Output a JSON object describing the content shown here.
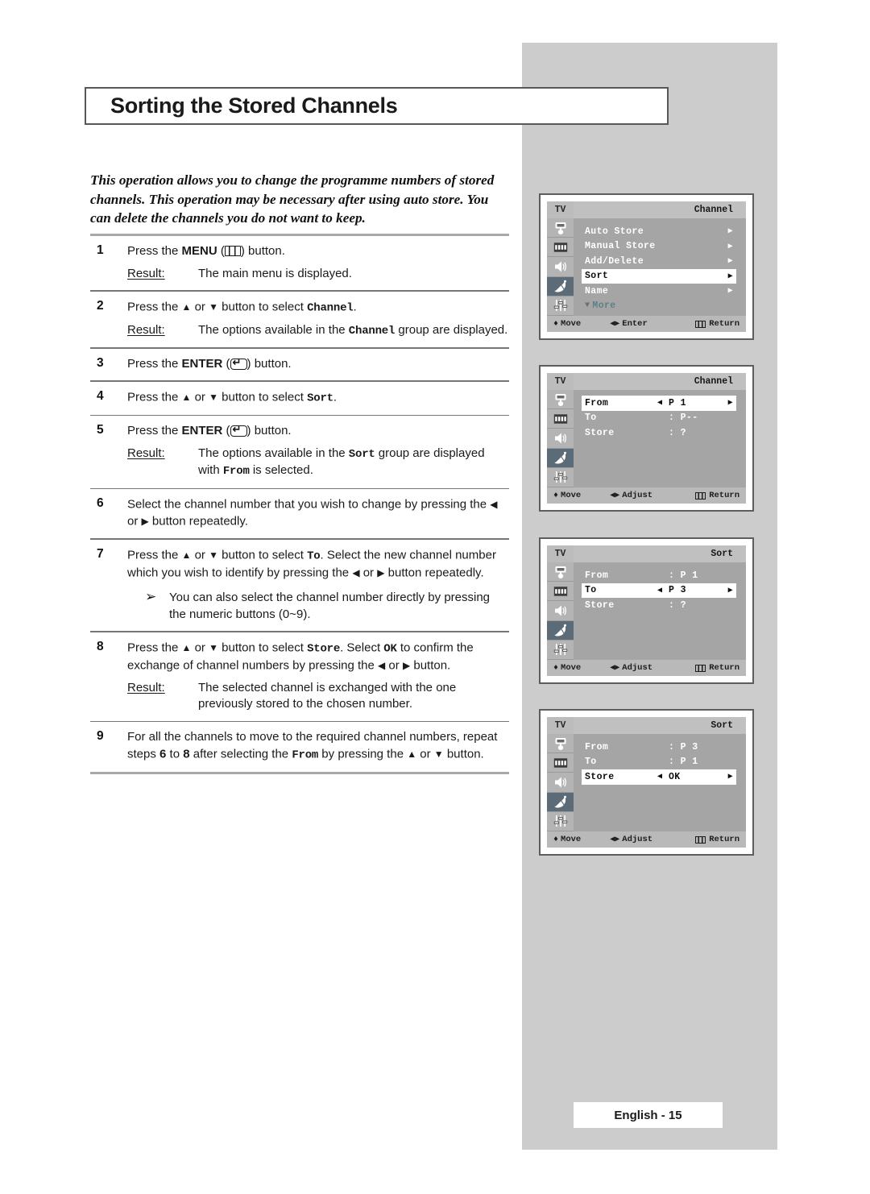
{
  "page": {
    "title": "Sorting the Stored Channels",
    "intro": "This operation allows you to change the programme numbers of stored channels. This operation may be necessary after using auto store. You can delete the channels you do not want to keep.",
    "footer_label": "English - 15"
  },
  "steps": [
    {
      "num": "1",
      "main_pre": "Press the ",
      "main_kbd": "MENU",
      "main_post": " button.",
      "result_label": "Result:",
      "result_text": "The main menu is displayed."
    },
    {
      "num": "2",
      "main_pre": "Press the ",
      "main_mid": " or ",
      "main_post": " button to select ",
      "main_code": "Channel",
      "main_tail": ".",
      "result_label": "Result:",
      "result_pre": "The options available in the ",
      "result_code": "Channel",
      "result_post": " group are displayed."
    },
    {
      "num": "3",
      "main_pre": "Press the ",
      "main_kbd": "ENTER",
      "main_post": " button."
    },
    {
      "num": "4",
      "main_pre": "Press the ",
      "main_mid": " or ",
      "main_post": " button to select ",
      "main_code": "Sort",
      "main_tail": "."
    },
    {
      "num": "5",
      "main_pre": "Press the ",
      "main_kbd": "ENTER",
      "main_post": " button.",
      "result_label": "Result:",
      "result_pre": "The options available in the ",
      "result_code": "Sort",
      "result_mid": " group are displayed with ",
      "result_code2": "From",
      "result_post": " is selected."
    },
    {
      "num": "6",
      "text_a": "Select the channel number that you wish to change by pressing the ",
      "text_b": " or ",
      "text_c": " button repeatedly."
    },
    {
      "num": "7",
      "t1": "Press the ",
      "t2": " or ",
      "t3": " button to select ",
      "code1": "To",
      "t4": ". Select the new channel number which you wish to identify by pressing the ",
      "t5": " or ",
      "t6": " button repeatedly.",
      "note": "You can also select the channel number directly by pressing the numeric buttons (0~9)."
    },
    {
      "num": "8",
      "t1": "Press the ",
      "t2": " or ",
      "t3": " button to select ",
      "code1": "Store",
      "t4": ". Select ",
      "code2": "OK",
      "t5": " to confirm the exchange of channel numbers by pressing the ",
      "t6": " or ",
      "t7": " button.",
      "result_label": "Result:",
      "result_text": "The selected channel is exchanged with the one previously stored to the chosen number."
    },
    {
      "num": "9",
      "t1": "For all the channels to move to the required channel numbers, repeat steps ",
      "b1": "6",
      "t2": " to ",
      "b2": "8",
      "t3": " after selecting the ",
      "code1": "From",
      "t4": " by pressing the ",
      "t5": " or ",
      "t6": " button."
    }
  ],
  "osd_panels": [
    {
      "tv_label": "TV",
      "title": "Channel",
      "rows": [
        {
          "label": "Auto Store",
          "arrow_right": "▶",
          "selected": false
        },
        {
          "label": "Manual Store",
          "arrow_right": "▶",
          "selected": false
        },
        {
          "label": "Add/Delete",
          "arrow_right": "▶",
          "selected": false
        },
        {
          "label": "Sort",
          "arrow_right": "▶",
          "selected": true
        },
        {
          "label": "Name",
          "arrow_right": "▶",
          "selected": false
        },
        {
          "label": "More",
          "more": true,
          "selected": false
        }
      ],
      "bottom": [
        {
          "glyph": "up-down-arrow-icon",
          "label": "Move"
        },
        {
          "glyph": "left-right-arrow-icon",
          "label": "Enter"
        },
        {
          "glyph": "menu-icon",
          "label": "Return"
        }
      ]
    },
    {
      "tv_label": "TV",
      "title": "Channel",
      "rows": [
        {
          "label": "From",
          "value": "P 1",
          "selected": true,
          "adjust": true
        },
        {
          "label": "To",
          "value": ": P--",
          "selected": false
        },
        {
          "label": "Store",
          "value": ": ?",
          "selected": false
        }
      ],
      "bottom": [
        {
          "glyph": "up-down-arrow-icon",
          "label": "Move"
        },
        {
          "glyph": "left-right-arrow-icon",
          "label": "Adjust"
        },
        {
          "glyph": "menu-icon",
          "label": "Return"
        }
      ]
    },
    {
      "tv_label": "TV",
      "title": "Sort",
      "rows": [
        {
          "label": "From",
          "value": ": P 1",
          "selected": false
        },
        {
          "label": "To",
          "value": "P 3",
          "selected": true,
          "adjust": true
        },
        {
          "label": "Store",
          "value": ": ?",
          "selected": false
        }
      ],
      "bottom": [
        {
          "glyph": "up-down-arrow-icon",
          "label": "Move"
        },
        {
          "glyph": "left-right-arrow-icon",
          "label": "Adjust"
        },
        {
          "glyph": "menu-icon",
          "label": "Return"
        }
      ]
    },
    {
      "tv_label": "TV",
      "title": "Sort",
      "rows": [
        {
          "label": "From",
          "value": ": P 3",
          "selected": false
        },
        {
          "label": "To",
          "value": ": P 1",
          "selected": false
        },
        {
          "label": "Store",
          "value": "OK",
          "selected": true,
          "adjust": true
        }
      ],
      "bottom": [
        {
          "glyph": "up-down-arrow-icon",
          "label": "Move"
        },
        {
          "glyph": "left-right-arrow-icon",
          "label": "Adjust"
        },
        {
          "glyph": "menu-icon",
          "label": "Return"
        }
      ]
    }
  ],
  "osd_rail_icons": [
    "picture-icon",
    "bars-icon",
    "speaker-icon",
    "satellite-dish-icon",
    "sliders-icon"
  ],
  "colors": {
    "gray_column": "#cccccc",
    "osd_body": "#a5a5a5",
    "osd_header": "#c0c0c0",
    "osd_footer": "#b9b9b9",
    "osd_rail_active": "#5b6b77",
    "more_text": "#5e7f88"
  },
  "glyphs": {
    "up": "▲",
    "down": "▼",
    "left": "◀",
    "right": "▶",
    "updown": "♦",
    "note_arrow": "➢"
  }
}
